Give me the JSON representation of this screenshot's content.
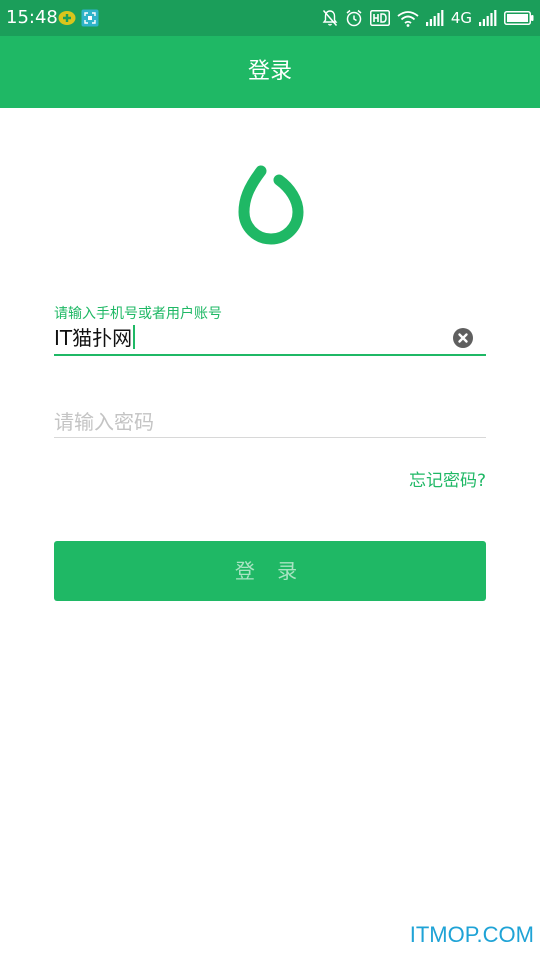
{
  "status_bar": {
    "time": "15:48",
    "network_label": "4G",
    "left_icons": [
      "app-badge-icon",
      "screenshot-icon"
    ],
    "right_icons": [
      "notifications-off-icon",
      "alarm-icon",
      "hd-icon",
      "wifi-icon",
      "signal-icon",
      "signal-icon",
      "battery-icon"
    ]
  },
  "app_bar": {
    "title": "登录"
  },
  "form": {
    "account_label": "请输入手机号或者用户账号",
    "account_value": "IT猫扑网",
    "password_placeholder": "请输入密码",
    "forgot_password": "忘记密码?",
    "login_button": "登 录"
  },
  "watermark": "ITMOP.COM",
  "colors": {
    "status_bar": "#1b9e5a",
    "app_bar": "#1fb865",
    "accent": "#1fb865",
    "button_text": "#a9e4c3"
  }
}
